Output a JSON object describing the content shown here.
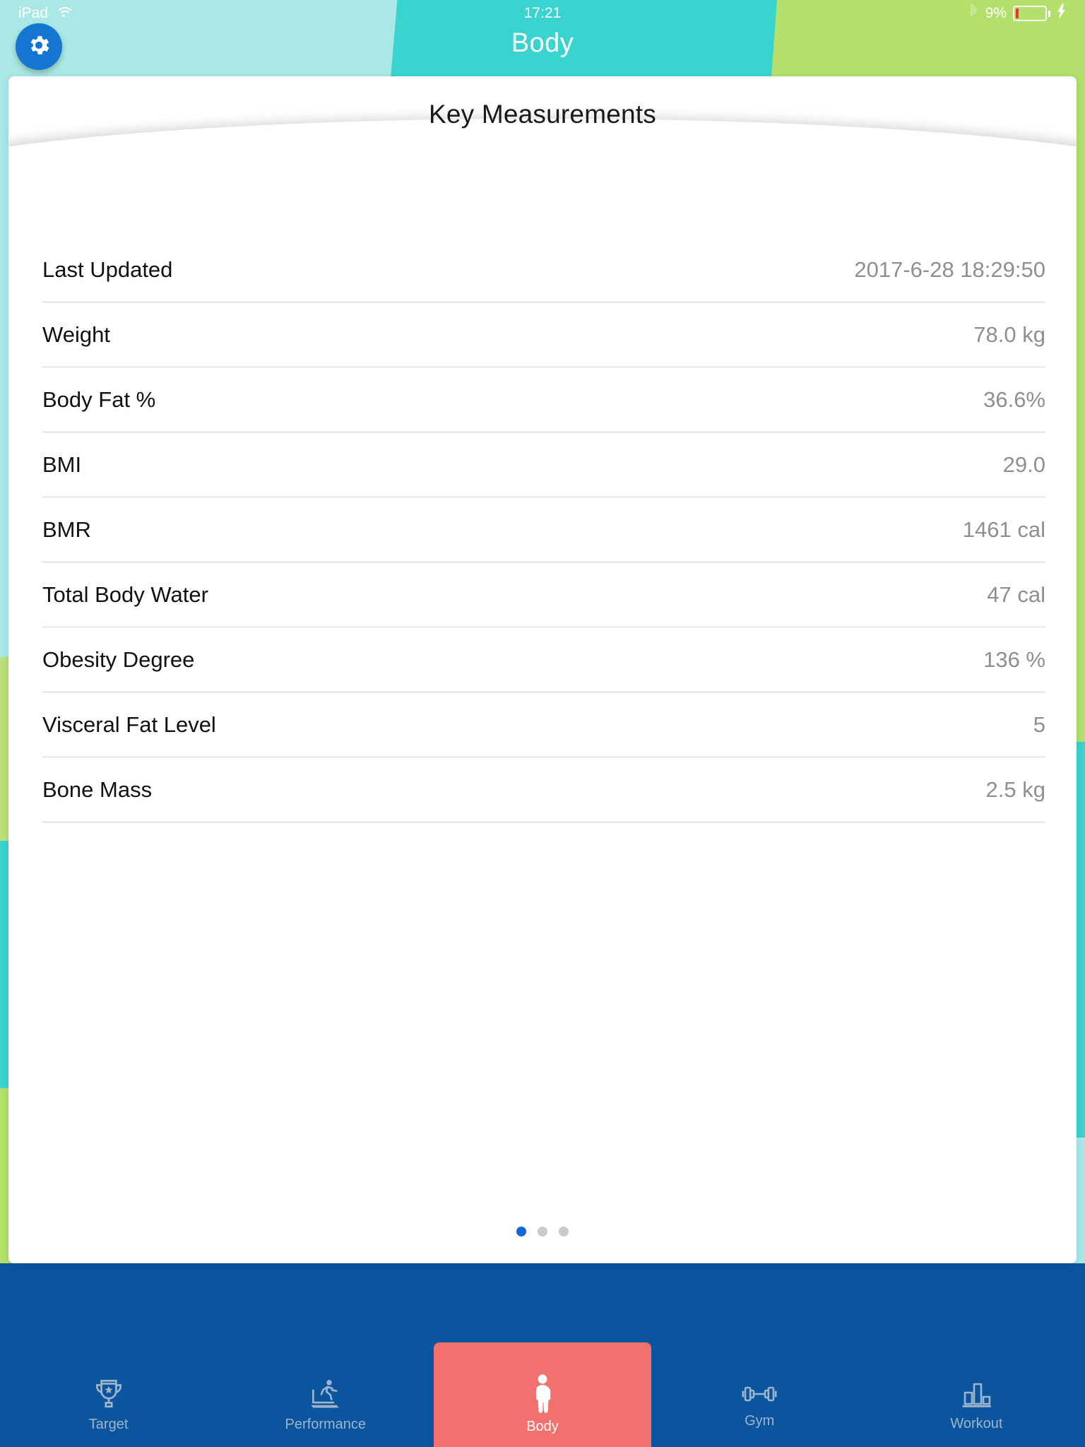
{
  "status_bar": {
    "device": "iPad",
    "wifi_icon": "wifi-icon",
    "time": "17:21",
    "bluetooth_icon": "bluetooth-icon",
    "battery_percent": "9%",
    "battery_level": 9,
    "charging_icon": "lightning-bolt-icon"
  },
  "header": {
    "settings_icon": "gear-icon",
    "title": "Body"
  },
  "card": {
    "title": "Key Measurements",
    "rows": [
      {
        "label": "Last Updated",
        "value": "2017-6-28 18:29:50"
      },
      {
        "label": "Weight",
        "value": "78.0 kg"
      },
      {
        "label": "Body Fat %",
        "value": "36.6%"
      },
      {
        "label": "BMI",
        "value": "29.0"
      },
      {
        "label": "BMR",
        "value": "1461 cal"
      },
      {
        "label": "Total Body Water",
        "value": "47 cal"
      },
      {
        "label": "Obesity Degree",
        "value": "136 %"
      },
      {
        "label": "Visceral  Fat Level",
        "value": "5"
      },
      {
        "label": "Bone Mass",
        "value": "2.5 kg"
      }
    ],
    "pagination": {
      "total": 3,
      "active_index": 0
    }
  },
  "tabbar": {
    "active_index": 2,
    "items": [
      {
        "label": "Target",
        "icon": "trophy-icon"
      },
      {
        "label": "Performance",
        "icon": "treadmill-runner-icon"
      },
      {
        "label": "Body",
        "icon": "person-icon"
      },
      {
        "label": "Gym",
        "icon": "dumbbell-icon"
      },
      {
        "label": "Workout",
        "icon": "bar-chart-icon"
      }
    ]
  },
  "colors": {
    "accent_blue": "#0a559e",
    "active_tab": "#f2706d",
    "bg_cyan": "#a9e8e4",
    "bg_teal": "#39d3d0",
    "bg_green": "#b2e06a",
    "value_gray": "#8e8e93",
    "gear_blue": "#1576d2",
    "battery_red": "#ff2e2e"
  }
}
